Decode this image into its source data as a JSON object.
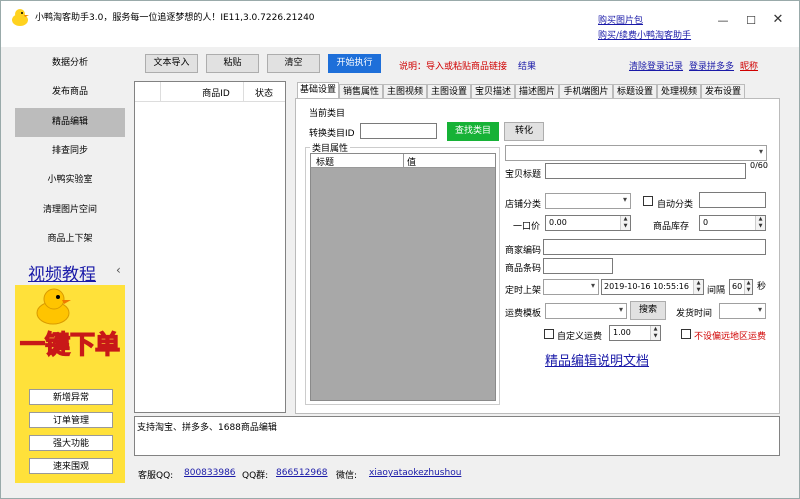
{
  "window": {
    "title": "小鸭淘客助手3.0，服务每一位追逐梦想的人！IE11,3.0.7226.21240",
    "top_links": [
      "购买图片包",
      "购买/续费小鸭淘客助手"
    ],
    "controls": [
      "minimize",
      "maximize",
      "close"
    ]
  },
  "sidebar": {
    "items": [
      "数据分析",
      "发布商品",
      "精品编辑",
      "排查同步",
      "小鸭实验室",
      "清理图片空间",
      "商品上下架"
    ],
    "active_index": 2,
    "video_tutorial": "视频教程",
    "collapse_glyph": "‹",
    "promo_text": "一键下单",
    "promo_buttons": [
      "新增异常",
      "订单管理",
      "强大功能",
      "速来围观"
    ]
  },
  "toolbar": {
    "buttons": [
      "文本导入",
      "粘贴",
      "清空",
      "开始执行"
    ],
    "hint": "说明：导入或粘贴商品链接",
    "result_label": "结果",
    "right_links": [
      "清除登录记录",
      "登录拼多多",
      "昵称"
    ]
  },
  "product_table": {
    "columns": [
      "商品ID",
      "状态"
    ]
  },
  "tabs": {
    "items": [
      "基础设置",
      "销售属性",
      "主图视频",
      "主图设置",
      "宝贝描述",
      "描述图片",
      "手机端图片",
      "标题设置",
      "处理视频",
      "发布设置"
    ],
    "active_index": 0
  },
  "basic_settings": {
    "current_category_label": "当前类目",
    "convert_category_label": "转换类目ID",
    "convert_category_value": "",
    "find_category_button": "查找类目",
    "convert_button": "转化",
    "category_attr_group": "类目属性",
    "attr_columns": [
      "标题",
      "值"
    ],
    "title_label": "宝贝标题",
    "title_value": "",
    "title_counter": "0/60",
    "shop_category_label": "店铺分类",
    "auto_category_label": "自动分类",
    "auto_category_checked": false,
    "price_label": "一口价",
    "price_value": "0.00",
    "stock_label": "商品库存",
    "stock_value": "0",
    "merchant_code_label": "商家编码",
    "barcode_label": "商品条码",
    "scheduled_listing_label": "定时上架",
    "scheduled_datetime": "2019-10-16  10:55:16",
    "interval_label": "间隔",
    "interval_value": "60",
    "interval_unit": "秒",
    "shipping_template_label": "运费模板",
    "search_button": "搜索",
    "ship_time_label": "发货时间",
    "custom_shipping_label": "自定义运费",
    "custom_shipping_checked": false,
    "custom_shipping_value": "1.00",
    "no_remote_label": "不设偏远地区运费",
    "no_remote_checked": false,
    "doc_link": "精品编辑说明文档"
  },
  "log": {
    "text": "支持淘宝、拼多多、1688商品编辑"
  },
  "footer": {
    "qq_label": "客服QQ:",
    "qq_value": "800833986",
    "group_label": "QQ群:",
    "group_value": "866512968",
    "wechat_label": "微信:",
    "wechat_value": "xiaoyataokezhushou"
  },
  "colors": {
    "primary_blue": "#1e6fd9",
    "green": "#16b236",
    "red": "#d00000",
    "link": "#1a1aa8",
    "promo_yellow": "#ffe13a",
    "grid_gray": "#a8a8a8"
  }
}
